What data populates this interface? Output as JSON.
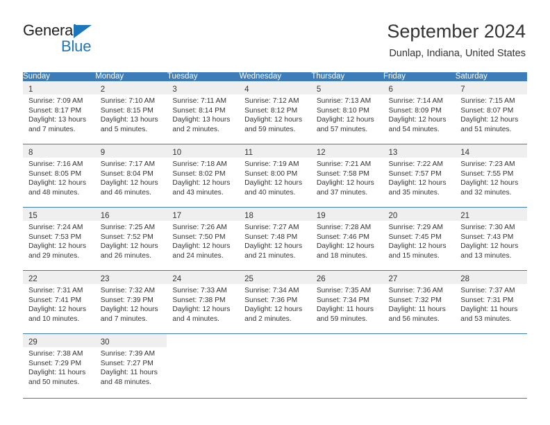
{
  "brand": {
    "name_part1": "General",
    "name_part2": "Blue",
    "triangle_color": "#1b76bc"
  },
  "header": {
    "title": "September 2024",
    "subtitle": "Dunlap, Indiana, United States",
    "header_bg_color": "#3b7cb9",
    "daynum_band_color": "#efefef"
  },
  "weekday_headers": [
    "Sunday",
    "Monday",
    "Tuesday",
    "Wednesday",
    "Thursday",
    "Friday",
    "Saturday"
  ],
  "weeks": [
    {
      "days": [
        {
          "num": "1",
          "sunrise": "Sunrise: 7:09 AM",
          "sunset": "Sunset: 8:17 PM",
          "daylight_line1": "Daylight: 13 hours",
          "daylight_line2": "and 7 minutes."
        },
        {
          "num": "2",
          "sunrise": "Sunrise: 7:10 AM",
          "sunset": "Sunset: 8:15 PM",
          "daylight_line1": "Daylight: 13 hours",
          "daylight_line2": "and 5 minutes."
        },
        {
          "num": "3",
          "sunrise": "Sunrise: 7:11 AM",
          "sunset": "Sunset: 8:14 PM",
          "daylight_line1": "Daylight: 13 hours",
          "daylight_line2": "and 2 minutes."
        },
        {
          "num": "4",
          "sunrise": "Sunrise: 7:12 AM",
          "sunset": "Sunset: 8:12 PM",
          "daylight_line1": "Daylight: 12 hours",
          "daylight_line2": "and 59 minutes."
        },
        {
          "num": "5",
          "sunrise": "Sunrise: 7:13 AM",
          "sunset": "Sunset: 8:10 PM",
          "daylight_line1": "Daylight: 12 hours",
          "daylight_line2": "and 57 minutes."
        },
        {
          "num": "6",
          "sunrise": "Sunrise: 7:14 AM",
          "sunset": "Sunset: 8:09 PM",
          "daylight_line1": "Daylight: 12 hours",
          "daylight_line2": "and 54 minutes."
        },
        {
          "num": "7",
          "sunrise": "Sunrise: 7:15 AM",
          "sunset": "Sunset: 8:07 PM",
          "daylight_line1": "Daylight: 12 hours",
          "daylight_line2": "and 51 minutes."
        }
      ]
    },
    {
      "days": [
        {
          "num": "8",
          "sunrise": "Sunrise: 7:16 AM",
          "sunset": "Sunset: 8:05 PM",
          "daylight_line1": "Daylight: 12 hours",
          "daylight_line2": "and 48 minutes."
        },
        {
          "num": "9",
          "sunrise": "Sunrise: 7:17 AM",
          "sunset": "Sunset: 8:04 PM",
          "daylight_line1": "Daylight: 12 hours",
          "daylight_line2": "and 46 minutes."
        },
        {
          "num": "10",
          "sunrise": "Sunrise: 7:18 AM",
          "sunset": "Sunset: 8:02 PM",
          "daylight_line1": "Daylight: 12 hours",
          "daylight_line2": "and 43 minutes."
        },
        {
          "num": "11",
          "sunrise": "Sunrise: 7:19 AM",
          "sunset": "Sunset: 8:00 PM",
          "daylight_line1": "Daylight: 12 hours",
          "daylight_line2": "and 40 minutes."
        },
        {
          "num": "12",
          "sunrise": "Sunrise: 7:21 AM",
          "sunset": "Sunset: 7:58 PM",
          "daylight_line1": "Daylight: 12 hours",
          "daylight_line2": "and 37 minutes."
        },
        {
          "num": "13",
          "sunrise": "Sunrise: 7:22 AM",
          "sunset": "Sunset: 7:57 PM",
          "daylight_line1": "Daylight: 12 hours",
          "daylight_line2": "and 35 minutes."
        },
        {
          "num": "14",
          "sunrise": "Sunrise: 7:23 AM",
          "sunset": "Sunset: 7:55 PM",
          "daylight_line1": "Daylight: 12 hours",
          "daylight_line2": "and 32 minutes."
        }
      ]
    },
    {
      "days": [
        {
          "num": "15",
          "sunrise": "Sunrise: 7:24 AM",
          "sunset": "Sunset: 7:53 PM",
          "daylight_line1": "Daylight: 12 hours",
          "daylight_line2": "and 29 minutes."
        },
        {
          "num": "16",
          "sunrise": "Sunrise: 7:25 AM",
          "sunset": "Sunset: 7:52 PM",
          "daylight_line1": "Daylight: 12 hours",
          "daylight_line2": "and 26 minutes."
        },
        {
          "num": "17",
          "sunrise": "Sunrise: 7:26 AM",
          "sunset": "Sunset: 7:50 PM",
          "daylight_line1": "Daylight: 12 hours",
          "daylight_line2": "and 24 minutes."
        },
        {
          "num": "18",
          "sunrise": "Sunrise: 7:27 AM",
          "sunset": "Sunset: 7:48 PM",
          "daylight_line1": "Daylight: 12 hours",
          "daylight_line2": "and 21 minutes."
        },
        {
          "num": "19",
          "sunrise": "Sunrise: 7:28 AM",
          "sunset": "Sunset: 7:46 PM",
          "daylight_line1": "Daylight: 12 hours",
          "daylight_line2": "and 18 minutes."
        },
        {
          "num": "20",
          "sunrise": "Sunrise: 7:29 AM",
          "sunset": "Sunset: 7:45 PM",
          "daylight_line1": "Daylight: 12 hours",
          "daylight_line2": "and 15 minutes."
        },
        {
          "num": "21",
          "sunrise": "Sunrise: 7:30 AM",
          "sunset": "Sunset: 7:43 PM",
          "daylight_line1": "Daylight: 12 hours",
          "daylight_line2": "and 13 minutes."
        }
      ]
    },
    {
      "days": [
        {
          "num": "22",
          "sunrise": "Sunrise: 7:31 AM",
          "sunset": "Sunset: 7:41 PM",
          "daylight_line1": "Daylight: 12 hours",
          "daylight_line2": "and 10 minutes."
        },
        {
          "num": "23",
          "sunrise": "Sunrise: 7:32 AM",
          "sunset": "Sunset: 7:39 PM",
          "daylight_line1": "Daylight: 12 hours",
          "daylight_line2": "and 7 minutes."
        },
        {
          "num": "24",
          "sunrise": "Sunrise: 7:33 AM",
          "sunset": "Sunset: 7:38 PM",
          "daylight_line1": "Daylight: 12 hours",
          "daylight_line2": "and 4 minutes."
        },
        {
          "num": "25",
          "sunrise": "Sunrise: 7:34 AM",
          "sunset": "Sunset: 7:36 PM",
          "daylight_line1": "Daylight: 12 hours",
          "daylight_line2": "and 2 minutes."
        },
        {
          "num": "26",
          "sunrise": "Sunrise: 7:35 AM",
          "sunset": "Sunset: 7:34 PM",
          "daylight_line1": "Daylight: 11 hours",
          "daylight_line2": "and 59 minutes."
        },
        {
          "num": "27",
          "sunrise": "Sunrise: 7:36 AM",
          "sunset": "Sunset: 7:32 PM",
          "daylight_line1": "Daylight: 11 hours",
          "daylight_line2": "and 56 minutes."
        },
        {
          "num": "28",
          "sunrise": "Sunrise: 7:37 AM",
          "sunset": "Sunset: 7:31 PM",
          "daylight_line1": "Daylight: 11 hours",
          "daylight_line2": "and 53 minutes."
        }
      ]
    },
    {
      "days": [
        {
          "num": "29",
          "sunrise": "Sunrise: 7:38 AM",
          "sunset": "Sunset: 7:29 PM",
          "daylight_line1": "Daylight: 11 hours",
          "daylight_line2": "and 50 minutes."
        },
        {
          "num": "30",
          "sunrise": "Sunrise: 7:39 AM",
          "sunset": "Sunset: 7:27 PM",
          "daylight_line1": "Daylight: 11 hours",
          "daylight_line2": "and 48 minutes."
        },
        {
          "num": "",
          "sunrise": "",
          "sunset": "",
          "daylight_line1": "",
          "daylight_line2": ""
        },
        {
          "num": "",
          "sunrise": "",
          "sunset": "",
          "daylight_line1": "",
          "daylight_line2": ""
        },
        {
          "num": "",
          "sunrise": "",
          "sunset": "",
          "daylight_line1": "",
          "daylight_line2": ""
        },
        {
          "num": "",
          "sunrise": "",
          "sunset": "",
          "daylight_line1": "",
          "daylight_line2": ""
        },
        {
          "num": "",
          "sunrise": "",
          "sunset": "",
          "daylight_line1": "",
          "daylight_line2": ""
        }
      ]
    }
  ]
}
